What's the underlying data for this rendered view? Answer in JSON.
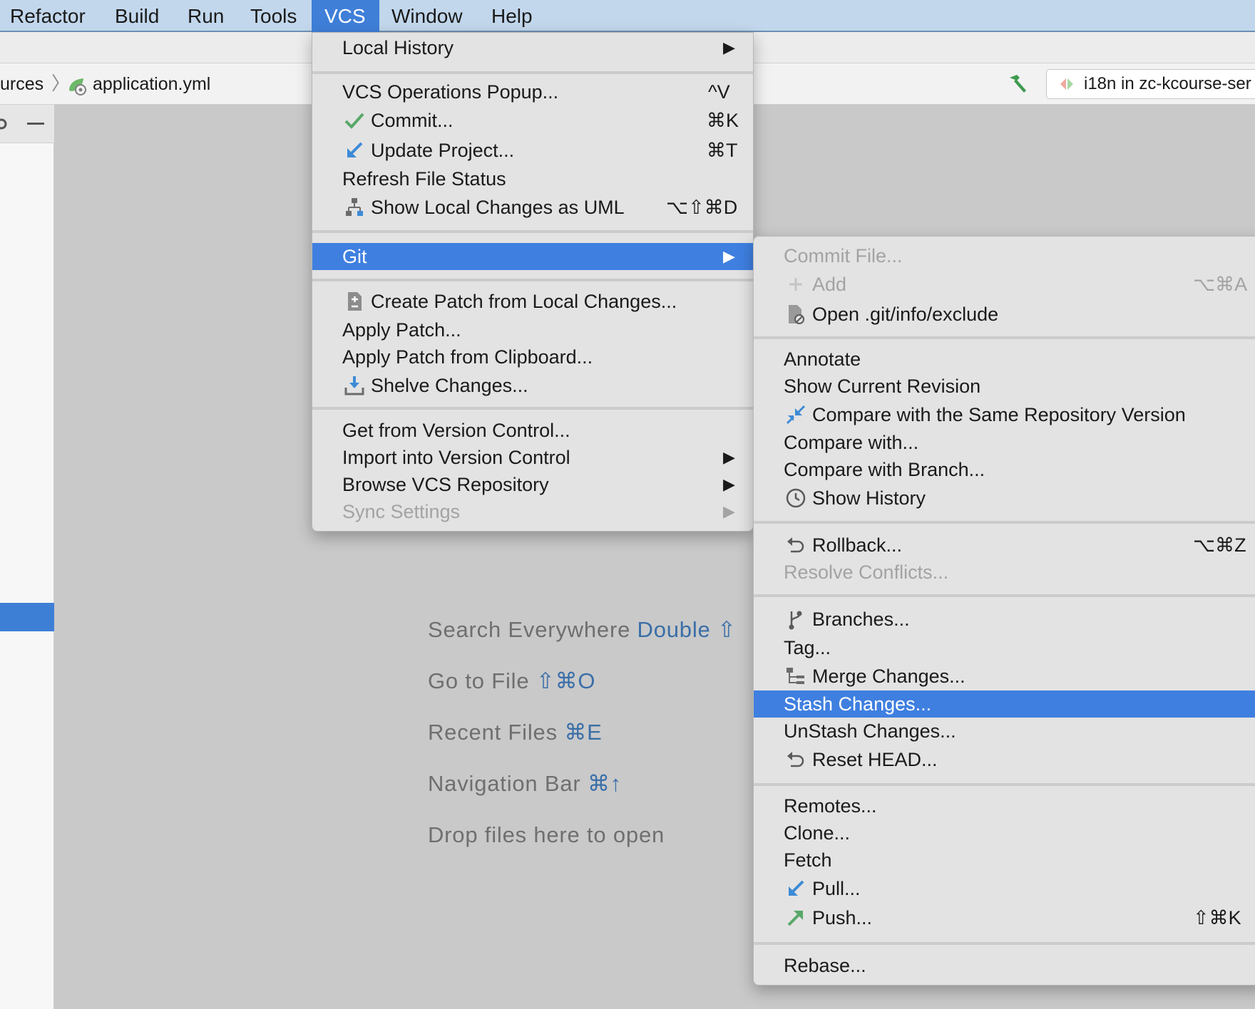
{
  "menubar": {
    "items": [
      "Refactor",
      "Build",
      "Run",
      "Tools",
      "VCS",
      "Window",
      "Help"
    ],
    "active": "VCS"
  },
  "navbar": {
    "crumb_prev": "urces",
    "crumb_file": "application.yml",
    "run_config": "i18n in zc-kcourse-ser"
  },
  "vcs_menu": {
    "local_history": "Local History",
    "vcs_operations": {
      "label": "VCS Operations Popup...",
      "shortcut": "^V"
    },
    "commit": {
      "label": "Commit...",
      "shortcut": "⌘K"
    },
    "update_project": {
      "label": "Update Project...",
      "shortcut": "⌘T"
    },
    "refresh_status": "Refresh File Status",
    "show_uml": {
      "label": "Show Local Changes as UML",
      "shortcut": "⌥⇧⌘D"
    },
    "git": "Git",
    "create_patch": "Create Patch from Local Changes...",
    "apply_patch": "Apply Patch...",
    "apply_patch_clipboard": "Apply Patch from Clipboard...",
    "shelve": "Shelve Changes...",
    "get_from_vc": "Get from Version Control...",
    "import_into_vc": "Import into Version Control",
    "browse_repo": "Browse VCS Repository",
    "sync_settings": "Sync Settings"
  },
  "git_menu": {
    "commit_file": "Commit File...",
    "add": {
      "label": "Add",
      "shortcut": "⌥⌘A"
    },
    "open_exclude": "Open .git/info/exclude",
    "annotate": "Annotate",
    "show_current_revision": "Show Current Revision",
    "compare_same_repo": "Compare with the Same Repository Version",
    "compare_with": "Compare with...",
    "compare_branch": "Compare with Branch...",
    "show_history": "Show History",
    "rollback": {
      "label": "Rollback...",
      "shortcut": "⌥⌘Z"
    },
    "resolve_conflicts": "Resolve Conflicts...",
    "branches": "Branches...",
    "tag": "Tag...",
    "merge_changes": "Merge Changes...",
    "stash_changes": "Stash Changes...",
    "unstash_changes": "UnStash Changes...",
    "reset_head": "Reset HEAD...",
    "remotes": "Remotes...",
    "clone": "Clone...",
    "fetch": "Fetch",
    "pull": "Pull...",
    "push": {
      "label": "Push...",
      "shortcut": "⇧⌘K"
    },
    "rebase": "Rebase..."
  },
  "editor_hints": {
    "search_everywhere": {
      "label": "Search Everywhere",
      "shortcut": "Double ⇧"
    },
    "go_to_file": {
      "label": "Go to File",
      "shortcut": "⇧⌘O"
    },
    "recent_files": {
      "label": "Recent Files",
      "shortcut": "⌘E"
    },
    "navigation_bar": {
      "label": "Navigation Bar",
      "shortcut": "⌘↑"
    },
    "drop_files": "Drop files here to open"
  },
  "colors": {
    "accent": "#3f7fe0",
    "menubar_bg": "#c2d7ec",
    "shortcut_blue": "#3a6ea8",
    "commit_green": "#59a869",
    "update_blue": "#3d8bd6"
  }
}
